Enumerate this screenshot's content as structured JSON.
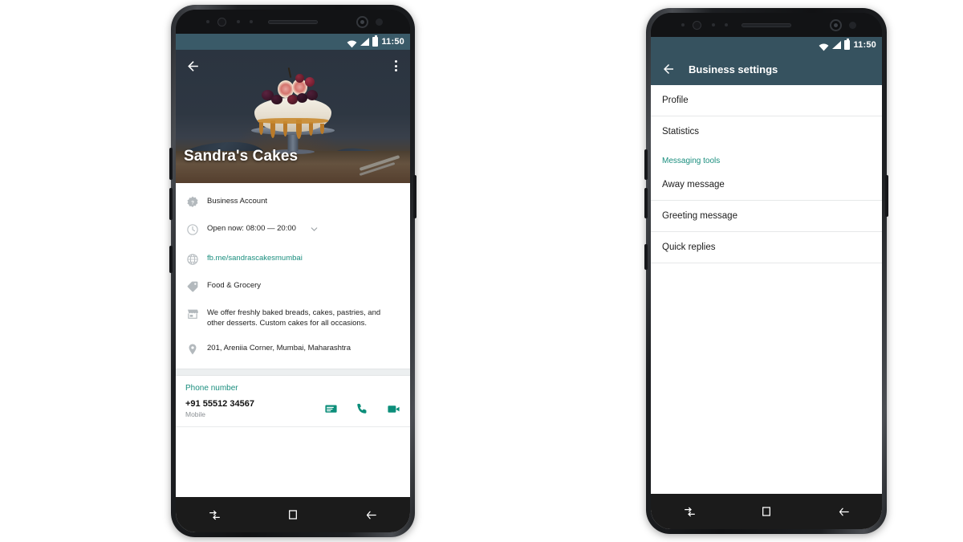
{
  "meta": {
    "app": "WhatsApp Business",
    "background_color": "#ffffff",
    "accent_teal": "#1a8e7e",
    "action_teal": "#0c8e7a",
    "appbar_color": "#36525f"
  },
  "left_phone": {
    "status_bar": {
      "time": "11:50",
      "icons": [
        "wifi-icon",
        "signal-icon",
        "battery-icon"
      ]
    },
    "cover": {
      "back_icon": "back-arrow-icon",
      "overflow_icon": "overflow-menu-icon",
      "business_name": "Sandra's Cakes",
      "photo_description": "pavlova cake with berries and figs on a glass cake stand"
    },
    "info_rows": [
      {
        "icon": "verified-business-icon",
        "text": "Business Account",
        "link": false,
        "chevron": false
      },
      {
        "icon": "clock-icon",
        "text": "Open now: 08:00 — 20:00",
        "link": false,
        "chevron": true
      },
      {
        "icon": "globe-icon",
        "text": "fb.me/sandrascakesmumbai",
        "link": true,
        "chevron": false
      },
      {
        "icon": "tag-icon",
        "text": "Food & Grocery",
        "link": false,
        "chevron": false
      },
      {
        "icon": "storefront-icon",
        "text": "We offer freshly baked breads, cakes, pastries, and other desserts. Custom cakes for all occasions.",
        "link": false,
        "chevron": false
      },
      {
        "icon": "location-pin-icon",
        "text": "201, Areniia Corner, Mumbai, Maharashtra",
        "link": false,
        "chevron": false
      }
    ],
    "phone_section": {
      "section_label": "Phone number",
      "number": "+91 55512 34567",
      "type": "Mobile",
      "actions": [
        "message-icon",
        "call-icon",
        "video-call-icon"
      ]
    },
    "nav_bar": {
      "recents_label": "recents-icon",
      "home_label": "home-icon",
      "back_label": "back-icon"
    }
  },
  "right_phone": {
    "status_bar": {
      "time": "11:50",
      "icons": [
        "wifi-icon",
        "signal-icon",
        "battery-icon"
      ]
    },
    "app_bar": {
      "back_icon": "back-arrow-icon",
      "title": "Business settings"
    },
    "settings": [
      {
        "kind": "item",
        "label": "Profile"
      },
      {
        "kind": "item",
        "label": "Statistics"
      },
      {
        "kind": "group",
        "label": "Messaging tools"
      },
      {
        "kind": "item",
        "label": "Away message"
      },
      {
        "kind": "item",
        "label": "Greeting message"
      },
      {
        "kind": "item",
        "label": "Quick replies"
      }
    ],
    "nav_bar": {
      "recents_label": "recents-icon",
      "home_label": "home-icon",
      "back_label": "back-icon"
    }
  }
}
